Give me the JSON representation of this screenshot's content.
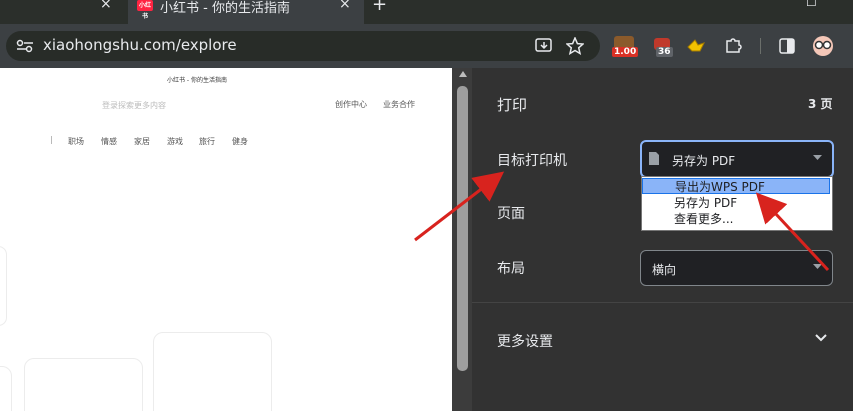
{
  "tabs": [
    {
      "close_icon": "×"
    },
    {
      "title": "小红书 - 你的生活指南",
      "close_icon": "×",
      "favicon_text": "小红书"
    }
  ],
  "new_tab_icon": "+",
  "window_controls": {
    "minimize": "—",
    "maximize": "☐"
  },
  "address_bar": {
    "url": "xiaohongshu.com/explore"
  },
  "extensions": {
    "badge_1": "1.00",
    "badge_2": "36"
  },
  "page": {
    "title": "小红书 - 你的生活指南",
    "search_placeholder": "登录探索更多内容",
    "header_links": [
      "创作中心",
      "业务合作"
    ],
    "categories": [
      "职场",
      "情感",
      "家居",
      "游戏",
      "旅行",
      "健身"
    ]
  },
  "print_panel": {
    "title": "打印",
    "page_count": "3 页",
    "destination_label": "目标打印机",
    "destination_value": "另存为 PDF",
    "destination_options": [
      "导出为WPS PDF",
      "另存为 PDF",
      "查看更多..."
    ],
    "pages_label": "页面",
    "layout_label": "布局",
    "layout_value": "横向",
    "more_settings_label": "更多设置"
  },
  "colors": {
    "accent": "#8ab4f8",
    "arrow": "#d8231e",
    "brand": "#ff2442"
  }
}
